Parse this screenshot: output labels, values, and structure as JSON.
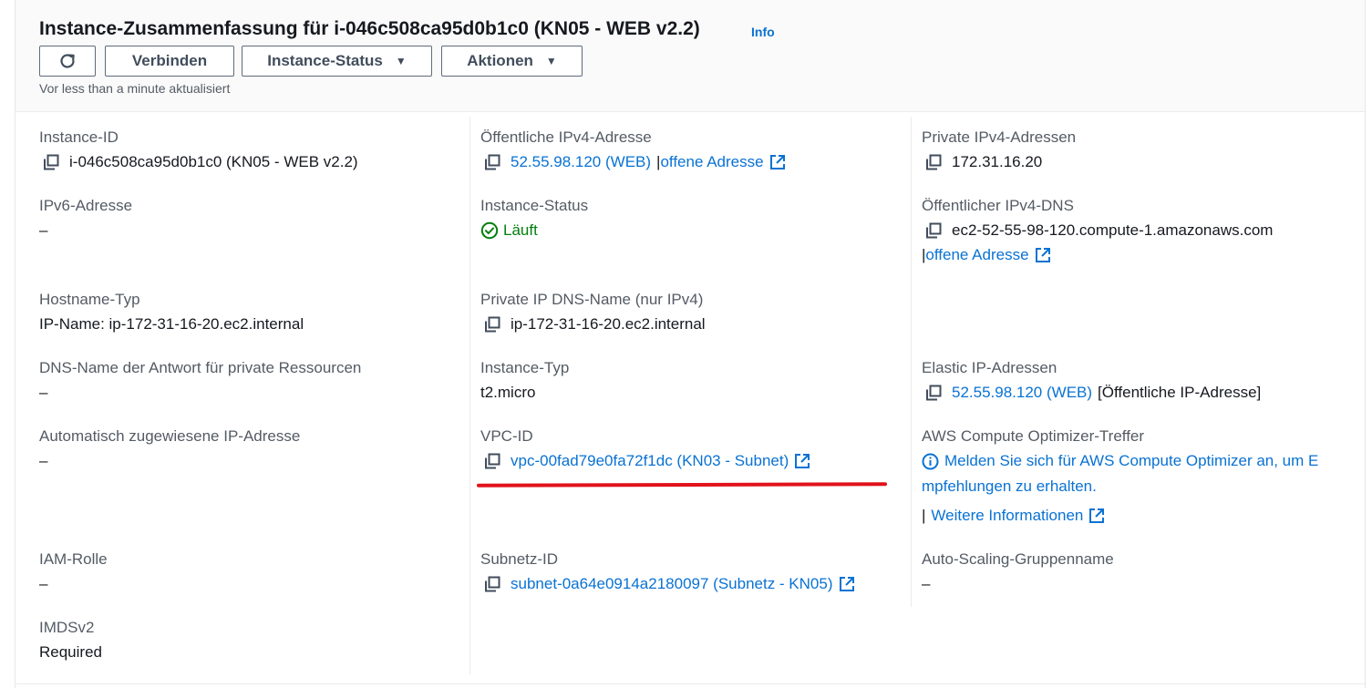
{
  "header": {
    "title": "Instance-Zusammenfassung für i-046c508ca95d0b1c0 (KN05 - WEB v2.2)",
    "info_label": "Info",
    "connect_label": "Verbinden",
    "status_label": "Instance-Status",
    "actions_label": "Aktionen",
    "updated_text": "Vor less than a minute aktualisiert"
  },
  "col1": {
    "instance_id_label": "Instance-ID",
    "instance_id_value": "i-046c508ca95d0b1c0 (KN05 - WEB v2.2)",
    "ipv6_label": "IPv6-Adresse",
    "ipv6_value": "–",
    "hostname_type_label": "Hostname-Typ",
    "hostname_type_value": "IP-Name: ip-172-31-16-20.ec2.internal",
    "dns_answer_label": "DNS-Name der Antwort für private Ressourcen",
    "dns_answer_value": "–",
    "auto_ip_label": "Automatisch zugewiesene IP-Adresse",
    "auto_ip_value": "–",
    "iam_label": "IAM-Rolle",
    "iam_value": "–",
    "imds_label": "IMDSv2",
    "imds_value": "Required"
  },
  "col2": {
    "public_ipv4_label": "Öffentliche IPv4-Adresse",
    "public_ipv4_value": "52.55.98.120 (WEB)",
    "open_address_sep": "|",
    "open_address_label": "offene Adresse",
    "instance_status_label": "Instance-Status",
    "instance_status_value": "Läuft",
    "private_dns_label": "Private IP DNS-Name (nur IPv4)",
    "private_dns_value": "ip-172-31-16-20.ec2.internal",
    "instance_type_label": "Instance-Typ",
    "instance_type_value": "t2.micro",
    "vpc_label": "VPC-ID",
    "vpc_value": "vpc-00fad79e0fa72f1dc (KN03 - Subnet)",
    "subnet_label": "Subnetz-ID",
    "subnet_value": "subnet-0a64e0914a2180097 (Subnetz - KN05)"
  },
  "col3": {
    "private_ipv4_label": "Private IPv4-Adressen",
    "private_ipv4_value": "172.31.16.20",
    "public_dns_label": "Öffentlicher IPv4-DNS",
    "public_dns_value": "ec2-52-55-98-120.compute-1.amazonaws.com",
    "open_address_sep": "|",
    "open_address_label": "offene Adresse",
    "elastic_ip_label": "Elastic IP-Adressen",
    "elastic_ip_value": "52.55.98.120 (WEB)",
    "elastic_ip_suffix": "[Öffentliche IP-Adresse]",
    "optimizer_label": "AWS Compute Optimizer-Treffer",
    "optimizer_line1": "Melden Sie sich für AWS Compute Optimizer an, um E",
    "optimizer_line2": "mpfehlungen zu erhalten.",
    "more_info_sep": "|",
    "more_info_label": "Weitere Informationen",
    "asg_label": "Auto-Scaling-Gruppenname",
    "asg_value": "–"
  },
  "icons": {
    "refresh": "refresh-icon",
    "copy": "copy-icon",
    "external": "external-link-icon",
    "status_ok": "check-circle-icon",
    "info": "info-circle-icon",
    "caret": "caret-down-icon"
  },
  "colors": {
    "link": "#0972d3",
    "status_ok": "#037f0c",
    "annotation": "#e1121b"
  }
}
